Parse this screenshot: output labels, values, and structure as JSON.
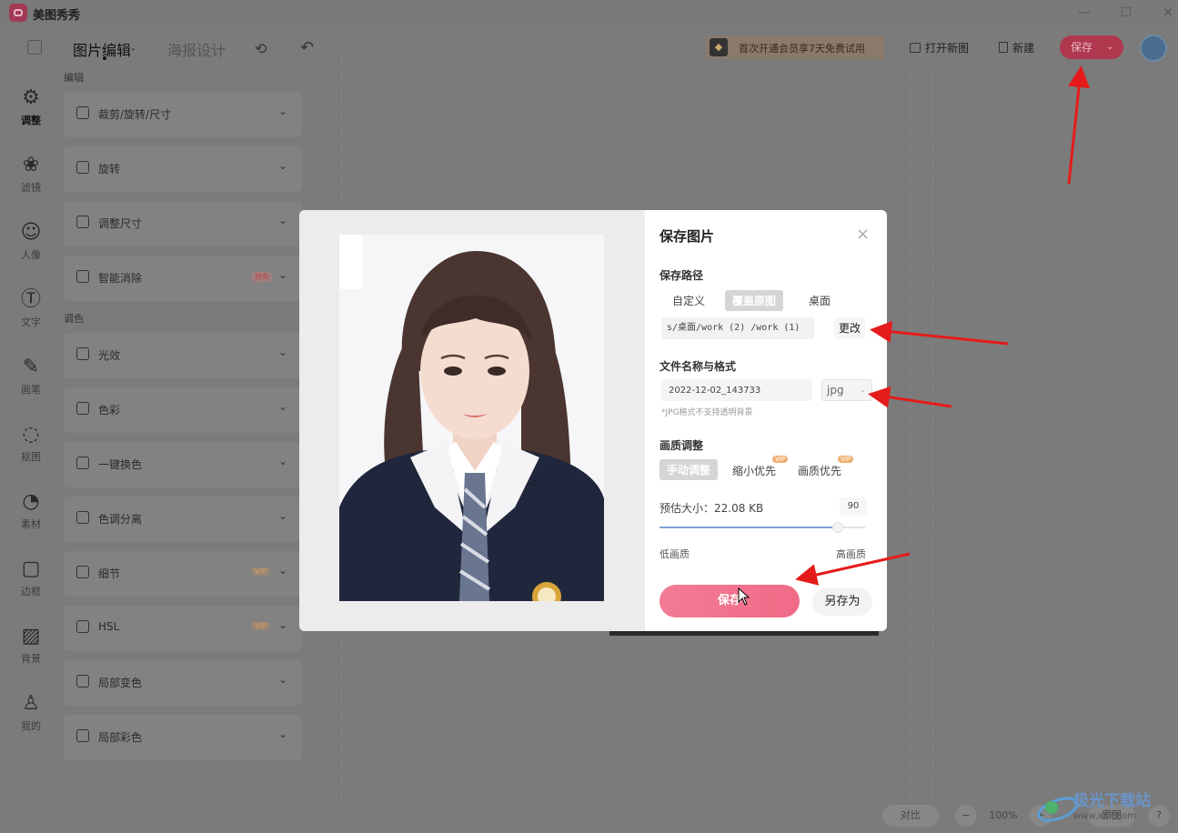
{
  "app": {
    "name": "美图秀秀"
  },
  "window_controls": {
    "minimize": "—",
    "maximize": "☐",
    "close": "✕"
  },
  "topbar": {
    "tab_edit": "图片编辑",
    "tab_edit_chevron": "˅",
    "tab_poster": "海报设计",
    "history_icon": "⟲",
    "undo_icon": "↶",
    "promo_text": "首次开通会员享7天免费试用",
    "open_image": "打开新图",
    "new": "新建",
    "save": "保存",
    "save_chevron": "⌄"
  },
  "left_nav": [
    {
      "icon": "⚙",
      "label": "调整",
      "active": true
    },
    {
      "icon": "❀",
      "label": "滤镜"
    },
    {
      "icon": "☺",
      "label": "人像"
    },
    {
      "icon": "Ⓣ",
      "label": "文字"
    },
    {
      "icon": "✎",
      "label": "画笔"
    },
    {
      "icon": "◌",
      "label": "抠图"
    },
    {
      "icon": "◔",
      "label": "素材"
    },
    {
      "icon": "▢",
      "label": "边框"
    },
    {
      "icon": "▨",
      "label": "背景"
    },
    {
      "icon": "♙",
      "label": "我的"
    }
  ],
  "tool_panel": {
    "section_edit": "编辑",
    "section_color": "调色",
    "edit_tools": [
      {
        "label": "裁剪/旋转/尺寸"
      },
      {
        "label": "旋转"
      },
      {
        "label": "调整尺寸"
      },
      {
        "label": "智能消除",
        "badge": "限免"
      }
    ],
    "color_tools": [
      {
        "label": "光效"
      },
      {
        "label": "色彩"
      },
      {
        "label": "一键换色"
      },
      {
        "label": "色调分离"
      },
      {
        "label": "细节",
        "vip": "VIP"
      },
      {
        "label": "HSL",
        "vip": "VIP"
      },
      {
        "label": "局部变色"
      },
      {
        "label": "局部彩色"
      }
    ]
  },
  "bottom_controls": {
    "contrast": "对比",
    "zoom": "100%",
    "minus": "−",
    "plus": "+",
    "original": "原图",
    "help": "?"
  },
  "watermark": {
    "text": "极光下载站",
    "url": "www.xz7.com"
  },
  "dialog": {
    "title": "保存图片",
    "close": "×",
    "path_label": "保存路径",
    "path_options": [
      "自定义",
      "覆盖原图",
      "桌面"
    ],
    "path_value": "s/桌面/work (2) /work (1)",
    "change_button": "更改",
    "name_label": "文件名称与格式",
    "file_name": "2022-12-02_143733",
    "format": "jpg",
    "format_chevron": "⌄",
    "format_note": "*JPG格式不支持透明背景",
    "quality_label": "画质调整",
    "quality_options": [
      {
        "label": "手动调整",
        "active": true
      },
      {
        "label": "缩小优先",
        "vip": "VIP"
      },
      {
        "label": "画质优先",
        "vip": "VIP"
      }
    ],
    "estimate_label": "预估大小：",
    "estimate_value": "22.08 KB",
    "quality_value": "90",
    "quality_fraction": 0.9,
    "low_quality": "低画质",
    "high_quality": "高画质",
    "save_button": "保存",
    "save_as_button": "另存为"
  },
  "colors": {
    "accent": "#f16a86",
    "annotation_red": "#e51b1b",
    "slider_blue": "#7ea3d8"
  }
}
